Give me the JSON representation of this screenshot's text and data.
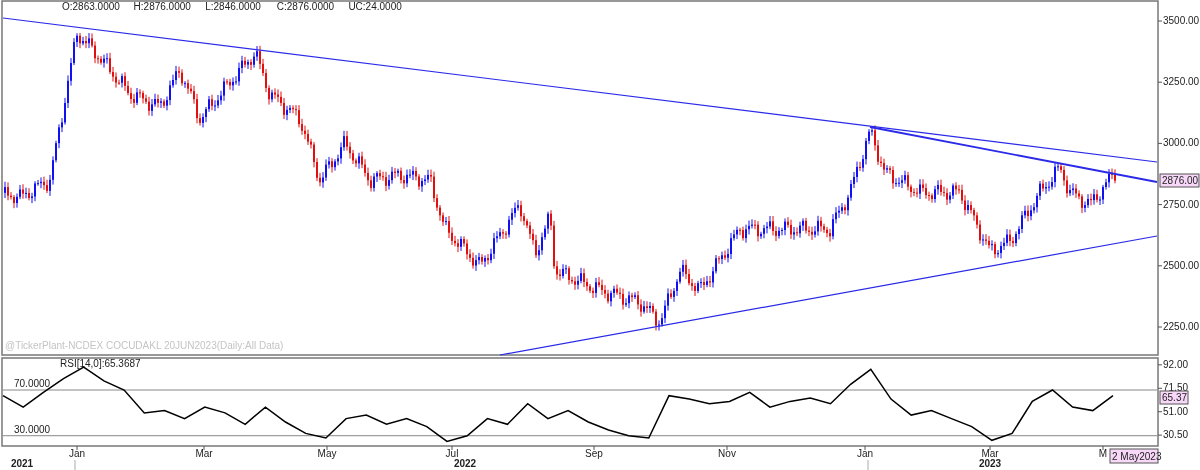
{
  "quote": [
    "O:2863.0000",
    "H:2876.0000",
    "L:2846.0000",
    "C:2876.0000",
    "UC:24.0000"
  ],
  "price_panel": {
    "caption": "@TickerPlant-NCDEX COCUDAKL 20JUN2023(Daily:All Data)",
    "y_labels": [
      "3500.00",
      "3250.00",
      "3000.00",
      "2750.00",
      "2500.00",
      "2250.00"
    ],
    "last_price": "2876.00"
  },
  "rsi_panel": {
    "label": "RSI[14,0]:65.3687",
    "level_labels": [
      "70.0000",
      "30.0000"
    ],
    "last_value": "65.37",
    "chart_data": {
      "type": "line",
      "ylim": [
        21,
        98
      ],
      "yticks": [
        {
          "value": 92,
          "label": "92.00"
        },
        {
          "value": 71.5,
          "label": "71.50"
        },
        {
          "value": 51,
          "label": "51.00"
        },
        {
          "value": 30.5,
          "label": "30.50"
        }
      ],
      "series": [
        {
          "color": "#000000",
          "values": [
            65,
            55,
            68,
            80,
            90,
            78,
            70,
            50,
            52,
            45,
            55,
            50,
            40,
            55,
            42,
            32,
            28,
            45,
            48,
            40,
            45,
            38,
            25,
            30,
            45,
            40,
            58,
            45,
            52,
            42,
            35,
            30,
            28,
            65,
            62,
            58,
            60,
            68,
            55,
            60,
            63,
            58,
            75,
            88,
            62,
            48,
            52,
            45,
            38,
            26,
            32,
            60,
            70,
            55,
            52,
            65
          ]
        }
      ]
    }
  },
  "time_axis": {
    "months": [
      "Jan",
      "Mar",
      "May",
      "Jul",
      "Sep",
      "Nov",
      "Jan",
      "Mar",
      "M"
    ],
    "years": [
      "2021",
      "2022",
      "2023"
    ],
    "cursor_date": "2 May2023"
  }
}
